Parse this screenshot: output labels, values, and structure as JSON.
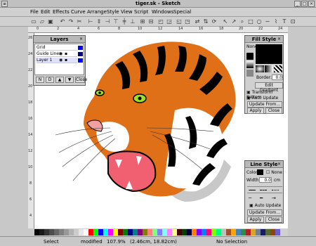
{
  "window": {
    "title": "tiger.sk - Sketch"
  },
  "menu": [
    "File",
    "Edit",
    "Effects",
    "Curve",
    "Arrange",
    "Style",
    "View",
    "Script",
    "Windows",
    "Special"
  ],
  "toolbar_icons": [
    "new-icon",
    "open-icon",
    "save-icon",
    "separator",
    "undo-icon",
    "redo-icon",
    "cut-icon",
    "align-left-icon",
    "align-center-icon",
    "align-right-icon",
    "align-top-icon",
    "align-middle-icon",
    "align-bottom-icon",
    "group-icon",
    "ungroup-icon",
    "front-icon",
    "back-icon",
    "forward-icon",
    "backward-icon",
    "flip-h-icon",
    "flip-v-icon",
    "rotate-icon",
    "select-icon",
    "edit-icon",
    "zoom-icon",
    "rectangle-icon",
    "ellipse-icon",
    "bezier-icon",
    "polyline-icon",
    "text-icon",
    "image-icon"
  ],
  "ruler": {
    "top_ticks": [
      "0",
      "2",
      "4",
      "6",
      "8",
      "10",
      "12",
      "14",
      "16",
      "18",
      "20",
      "22",
      "24"
    ],
    "left_ticks": [
      "26",
      "24",
      "22",
      "20",
      "18",
      "16",
      "14",
      "12",
      "10",
      "8",
      "6",
      "4"
    ]
  },
  "layers_panel": {
    "title": "Layers",
    "rows": [
      {
        "name": "Grid",
        "color": "#0000ff"
      },
      {
        "name": "Guide Lines",
        "color": "#000080"
      },
      {
        "name": "Layer 1",
        "color": "#0000ff"
      }
    ],
    "buttons": [
      "N",
      "D",
      "▲",
      "▼",
      "Close"
    ]
  },
  "fill_panel": {
    "title": "Fill Style",
    "none_label": "None",
    "border_label": "Border:",
    "border_value": "0.0",
    "edit_gradient": "Edit Gradient",
    "transform_pattern": "Transform Pattern",
    "auto_update": "Auto Update",
    "update_from": "Update From...",
    "apply": "Apply",
    "close": "Close"
  },
  "line_panel": {
    "title": "Line Style",
    "color_label": "Color",
    "none_label": "None",
    "width_label": "Width",
    "width_value": "0.0",
    "width_unit": "cm",
    "auto_update": "Auto Update",
    "update_from": "Update From...",
    "apply": "Apply",
    "close": "Close"
  },
  "palette": [
    "#000000",
    "#1a1a1a",
    "#333333",
    "#4d4d4d",
    "#666666",
    "#808080",
    "#999999",
    "#b3b3b3",
    "#cccccc",
    "#e6e6e6",
    "#ffffff",
    "#ff0000",
    "#00ff00",
    "#0000ff",
    "#00ffff",
    "#ff00ff",
    "#ffff00",
    "#800000",
    "#008000",
    "#000080",
    "#008080",
    "#800080",
    "#808000",
    "#ff8080",
    "#80ff80",
    "#8080ff",
    "#80ffff",
    "#ff80ff",
    "#ffff80",
    "#400000",
    "#004000",
    "#000040",
    "#ff8000",
    "#8000ff",
    "#0080ff",
    "#ff0080",
    "#80ff00",
    "#00ff80",
    "#c0c0c0",
    "#a0522d",
    "#ffa500",
    "#4682b4",
    "#2e8b57",
    "#b22222",
    "#daa520",
    "#708090",
    "#191970",
    "#556b2f",
    "#8b4513",
    "#6a5acd"
  ],
  "status": {
    "mode": "Select",
    "modified": "modified",
    "zoom": "107.9%",
    "coords": "(2.46cm, 18.82cm)",
    "selection": "No Selection"
  },
  "colors": {
    "orange": "#e07018",
    "dark_orange": "#b84808",
    "black": "#000000",
    "eye_green": "#9ee020",
    "mouth_pink": "#f06070",
    "nose_pink": "#f0a0a0",
    "shadow_gray": "#c8c8c8"
  }
}
